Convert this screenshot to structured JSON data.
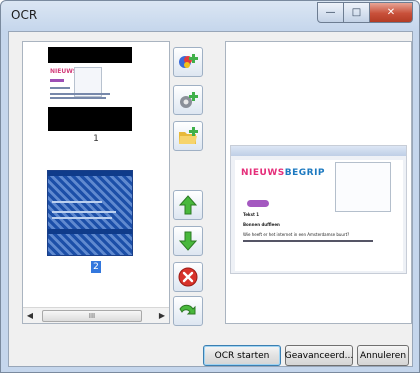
{
  "window": {
    "title": "OCR"
  },
  "thumbnails": [
    {
      "label": "1",
      "selected": false
    },
    {
      "label": "2",
      "selected": true
    }
  ],
  "scrollbar": {
    "grip": "III"
  },
  "tools": [
    {
      "name": "scan-add-icon"
    },
    {
      "name": "scanner-settings-icon"
    },
    {
      "name": "open-folder-icon"
    },
    {
      "name": "move-up-icon"
    },
    {
      "name": "move-down-icon"
    },
    {
      "name": "delete-icon"
    },
    {
      "name": "rotate-icon"
    }
  ],
  "preview": {
    "logo_a": "NIEUWS",
    "logo_b": "BEGRIP",
    "line1": "Tekst 1",
    "line2": "Bonnen duffleen",
    "line3": "Wie heeft er het internet in een Amsterdamse buurt?"
  },
  "buttons": {
    "ocr_start": "OCR starten",
    "advanced": "Geavanceerd...",
    "cancel": "Annuleren"
  },
  "colors": {
    "accent": "#3377dd",
    "close": "#c8503a"
  }
}
